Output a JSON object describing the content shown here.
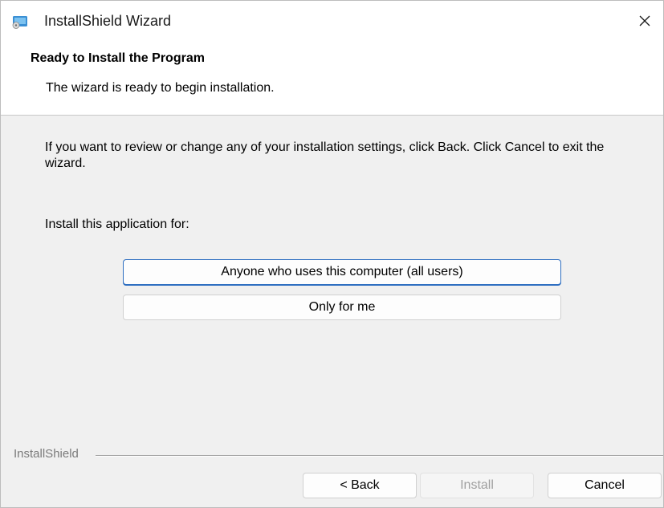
{
  "window": {
    "title": "InstallShield Wizard"
  },
  "header": {
    "title": "Ready to Install the Program",
    "subtitle": "The wizard is ready to begin installation."
  },
  "body": {
    "instructions": "If you want to review or change any of your installation settings, click Back. Click Cancel to exit the wizard.",
    "install_for_label": "Install this application for:",
    "options": [
      {
        "label": "Anyone who uses this computer (all users)",
        "focused": true
      },
      {
        "label": "Only for me",
        "focused": false
      }
    ]
  },
  "footer": {
    "brand": "InstallShield",
    "back_label": "< Back",
    "install_label": "Install",
    "install_enabled": false,
    "cancel_label": "Cancel"
  },
  "colors": {
    "focus_border": "#2f6fc1",
    "header_background": "#ffffff",
    "body_background": "#f0f0f0"
  },
  "icons": {
    "app": "installer-icon",
    "close": "close-icon"
  }
}
